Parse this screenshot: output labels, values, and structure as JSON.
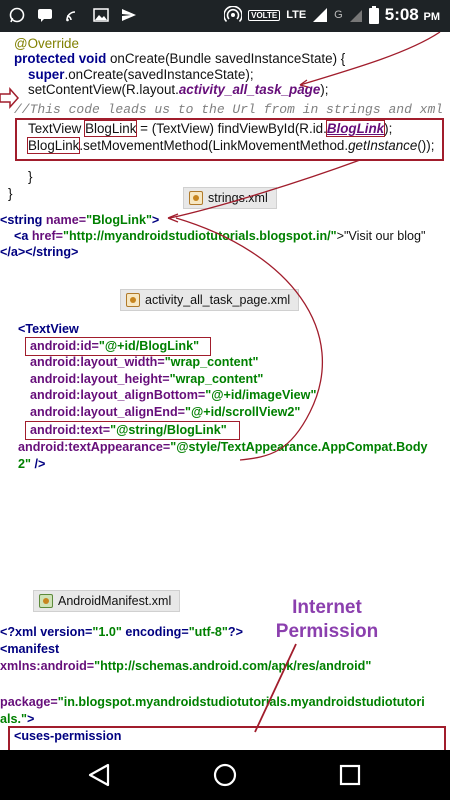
{
  "status_bar": {
    "time": "5:08",
    "ampm": "PM",
    "volte": "VOLTE",
    "lte": "LTE",
    "second_network": "G",
    "icons": [
      "whatsapp-icon",
      "message-icon",
      "cast-icon",
      "gallery-icon",
      "send-icon",
      "hotspot-icon",
      "signal-icon",
      "battery-icon"
    ]
  },
  "java_code": {
    "l1": "@Override",
    "l2_kw": "protected void",
    "l2_rest": " onCreate(Bundle savedInstanceState) {",
    "l3_kw": "super",
    "l3_rest": ".onCreate(savedInstanceState);",
    "l4_a": "setContentView(R.layout.",
    "l4_it": "activity_all_task_page",
    "l4_b": ");",
    "l5_comment": "//This code leads us to the Url from in strings and xml",
    "l6_a": "TextView ",
    "l6_box": "BlogLink",
    "l6_b": " = (TextView) findViewById(R.id.",
    "l6_it": "BlogLink",
    "l6_c": ");",
    "l7_box": "BlogLink",
    "l7_a": ".setMovementMethod(LinkMovementMethod.",
    "l7_it": "getInstance",
    "l7_b": "());",
    "l8": "}",
    "l9": "}"
  },
  "strings_tab": "strings.xml",
  "strings_xml": {
    "l1_tag": "<string",
    "l1_attr": " name=",
    "l1_val": "\"BlogLink\"",
    "l1_end": ">",
    "l2_tag": "<a",
    "l2_attr": " href=",
    "l2_val": "\"http://myandroidstudiotutorials.blogspot.in/\"",
    "l2_text": ">\"Visit our blog\"",
    "l3": "</a></string>"
  },
  "activity_tab": "activity_all_task_page.xml",
  "activity_xml": {
    "l1": "<TextView",
    "l2_attr": "android:id=",
    "l2_val": "\"@+id/BlogLink\"",
    "l3_attr": "android:layout_width=",
    "l3_val": "\"wrap_content\"",
    "l4_attr": "android:layout_height=",
    "l4_val": "\"wrap_content\"",
    "l5_attr": "android:layout_alignBottom=",
    "l5_val": "\"@+id/imageView\"",
    "l6_attr": "android:layout_alignEnd=",
    "l6_val": "\"@+id/scrollView2\"",
    "l7_attr": "android:text=",
    "l7_val": "\"@string/BlogLink\"",
    "l8_attr": "android:textAppearance=",
    "l8_val": "\"@style/TextAppearance.AppCompat.Body",
    "l9_val": "2\"",
    "l9_end": " />"
  },
  "manifest_tab": "AndroidManifest.xml",
  "permission_label_1": "Internet",
  "permission_label_2": "Permission",
  "manifest_xml": {
    "l1_a": "<?xml version=",
    "l1_v1": "\"1.0\"",
    "l1_b": " encoding=",
    "l1_v2": "\"utf-8\"",
    "l1_c": "?>",
    "l2": "<manifest",
    "l3_attr": "xmlns:android=",
    "l3_val": "\"http://schemas.android.com/apk/res/android\"",
    "l4_attr": "package=",
    "l4_val": "\"in.blogspot.myandroidstudiotutorials.myandroidstudiotutori",
    "l5_val": "als.\"",
    "l5_end": ">",
    "l6": "<uses-permission"
  },
  "nav": [
    "back-icon",
    "home-icon",
    "recents-icon"
  ]
}
